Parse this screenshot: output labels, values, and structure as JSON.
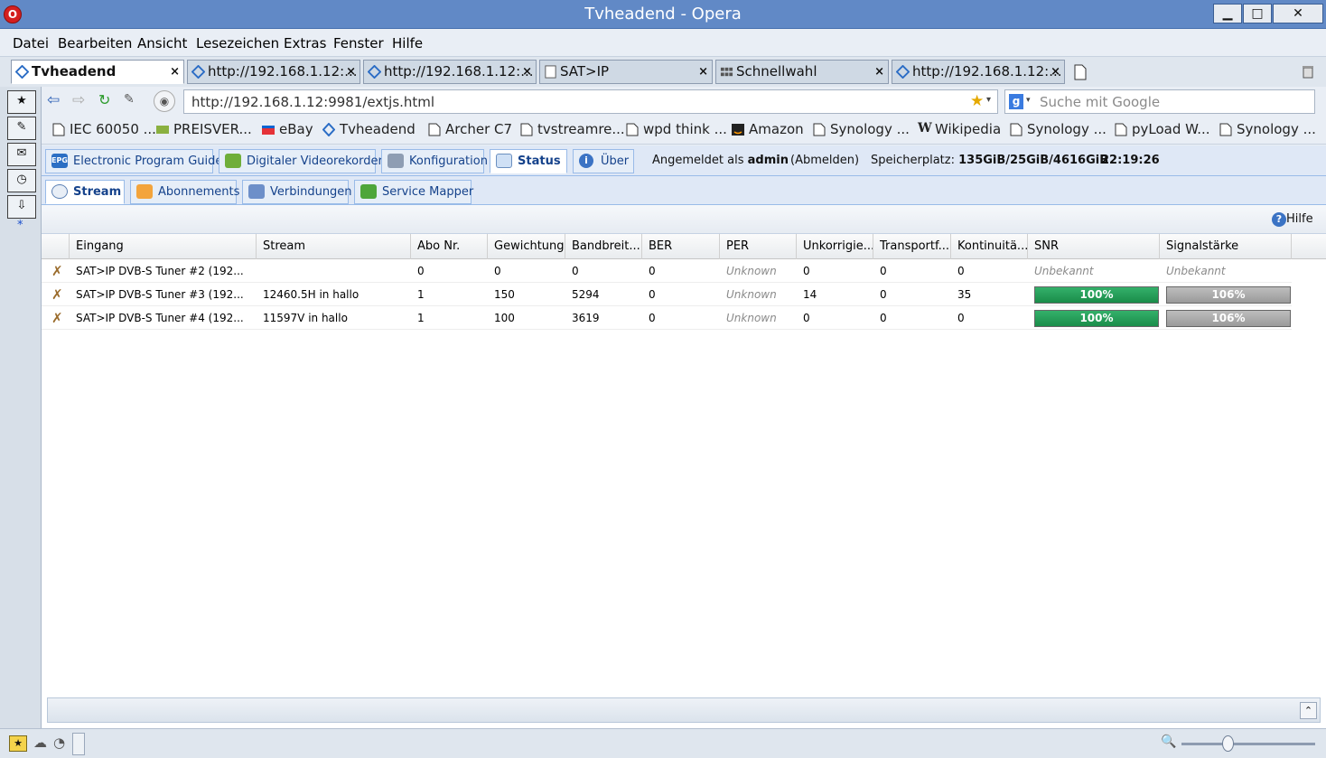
{
  "window": {
    "title": "Tvheadend - Opera",
    "minimize": "▁",
    "maximize": "□",
    "close": "✕"
  },
  "menu": [
    "Datei",
    "Bearbeiten",
    "Ansicht",
    "Lesezeichen",
    "Extras",
    "Fenster",
    "Hilfe"
  ],
  "tabs": [
    {
      "label": "Tvheadend",
      "active": true
    },
    {
      "label": "http://192.168.1.12:...",
      "active": false
    },
    {
      "label": "http://192.168.1.12:...",
      "active": false
    },
    {
      "label": "SAT>IP",
      "active": false
    },
    {
      "label": "Schnellwahl",
      "active": false
    },
    {
      "label": "http://192.168.1.12:...",
      "active": false
    }
  ],
  "address": {
    "url": "http://192.168.1.12:9981/extjs.html",
    "search_placeholder": "Suche mit Google"
  },
  "bookmarks": [
    "IEC 60050 ...",
    "PREISVER...",
    "eBay",
    "Tvheadend",
    "Archer C7",
    "tvstreamre...",
    "wpd think ...",
    "Amazon",
    "Synology ...",
    "Wikipedia",
    "Synology ...",
    "pyLoad W...",
    "Synology ..."
  ],
  "tvh": {
    "main_tabs": [
      "Electronic Program Guide",
      "Digitaler Videorekorder",
      "Konfiguration",
      "Status",
      "Über"
    ],
    "logged_in_prefix": "Angemeldet als",
    "user": "admin",
    "logout": "(Abmelden)",
    "storage_label": "Speicherplatz:",
    "storage_value": "135GiB/25GiB/4616GiB",
    "time": "22:19:26",
    "sub_tabs": [
      "Stream",
      "Abonnements",
      "Verbindungen",
      "Service Mapper"
    ],
    "help": "Hilfe"
  },
  "grid": {
    "columns": [
      "Eingang",
      "Stream",
      "Abo Nr.",
      "Gewichtung",
      "Bandbreit...",
      "BER",
      "PER",
      "Unkorrigie...",
      "Transportf...",
      "Kontinuitä...",
      "SNR",
      "Signalstärke"
    ],
    "rows": [
      {
        "input": "SAT>IP DVB-S Tuner #2 (192...",
        "stream": "",
        "subs": "0",
        "weight": "0",
        "bandwidth": "0",
        "ber": "0",
        "per": "Unknown",
        "unc": "0",
        "te": "0",
        "cc": "0",
        "snr_text": "Unbekannt",
        "signal_text": "Unbekannt",
        "snr_pct": null,
        "signal_pct": null
      },
      {
        "input": "SAT>IP DVB-S Tuner #3 (192...",
        "stream": "12460.5H in hallo",
        "subs": "1",
        "weight": "150",
        "bandwidth": "5294",
        "ber": "0",
        "per": "Unknown",
        "unc": "14",
        "te": "0",
        "cc": "35",
        "snr_text": "100%",
        "signal_text": "106%",
        "snr_pct": 100,
        "signal_pct": 106
      },
      {
        "input": "SAT>IP DVB-S Tuner #4 (192...",
        "stream": "11597V in hallo",
        "subs": "1",
        "weight": "100",
        "bandwidth": "3619",
        "ber": "0",
        "per": "Unknown",
        "unc": "0",
        "te": "0",
        "cc": "0",
        "snr_text": "100%",
        "signal_text": "106%",
        "snr_pct": 100,
        "signal_pct": 106
      }
    ]
  },
  "colors": {
    "titlebar": "#6189c6",
    "snr_bar": "#1f9a52",
    "signal_bar": "#a8a8a8",
    "ext_border": "#99bbe8"
  }
}
